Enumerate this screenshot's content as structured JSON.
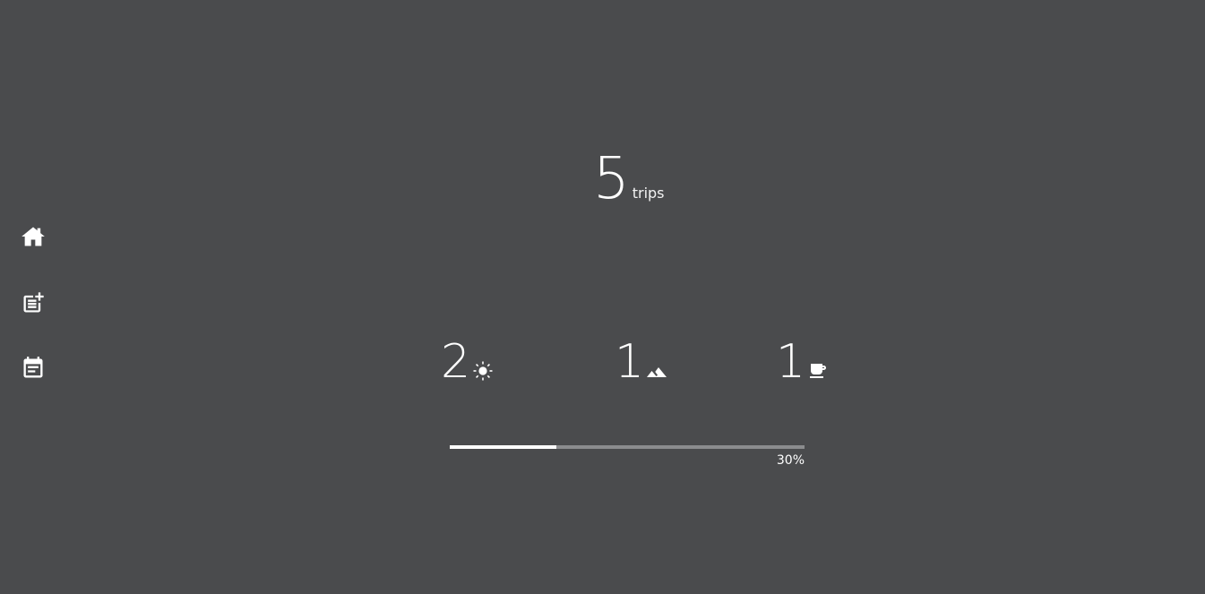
{
  "nav": {
    "items": [
      {
        "name": "home",
        "icon": "home-icon"
      },
      {
        "name": "add-trip",
        "icon": "post-add-icon"
      },
      {
        "name": "trip-list",
        "icon": "event-note-icon"
      }
    ]
  },
  "summary": {
    "total_count": "5",
    "total_unit": "trips"
  },
  "categories": [
    {
      "count": "2",
      "icon": "sun-icon"
    },
    {
      "count": "1",
      "icon": "terrain-icon"
    },
    {
      "count": "1",
      "icon": "coffee-icon"
    }
  ],
  "progress": {
    "percent": 30,
    "label": "30%"
  },
  "colors": {
    "background": "#4a4b4d",
    "foreground": "#ffffff",
    "track": "#8b8c8e"
  }
}
